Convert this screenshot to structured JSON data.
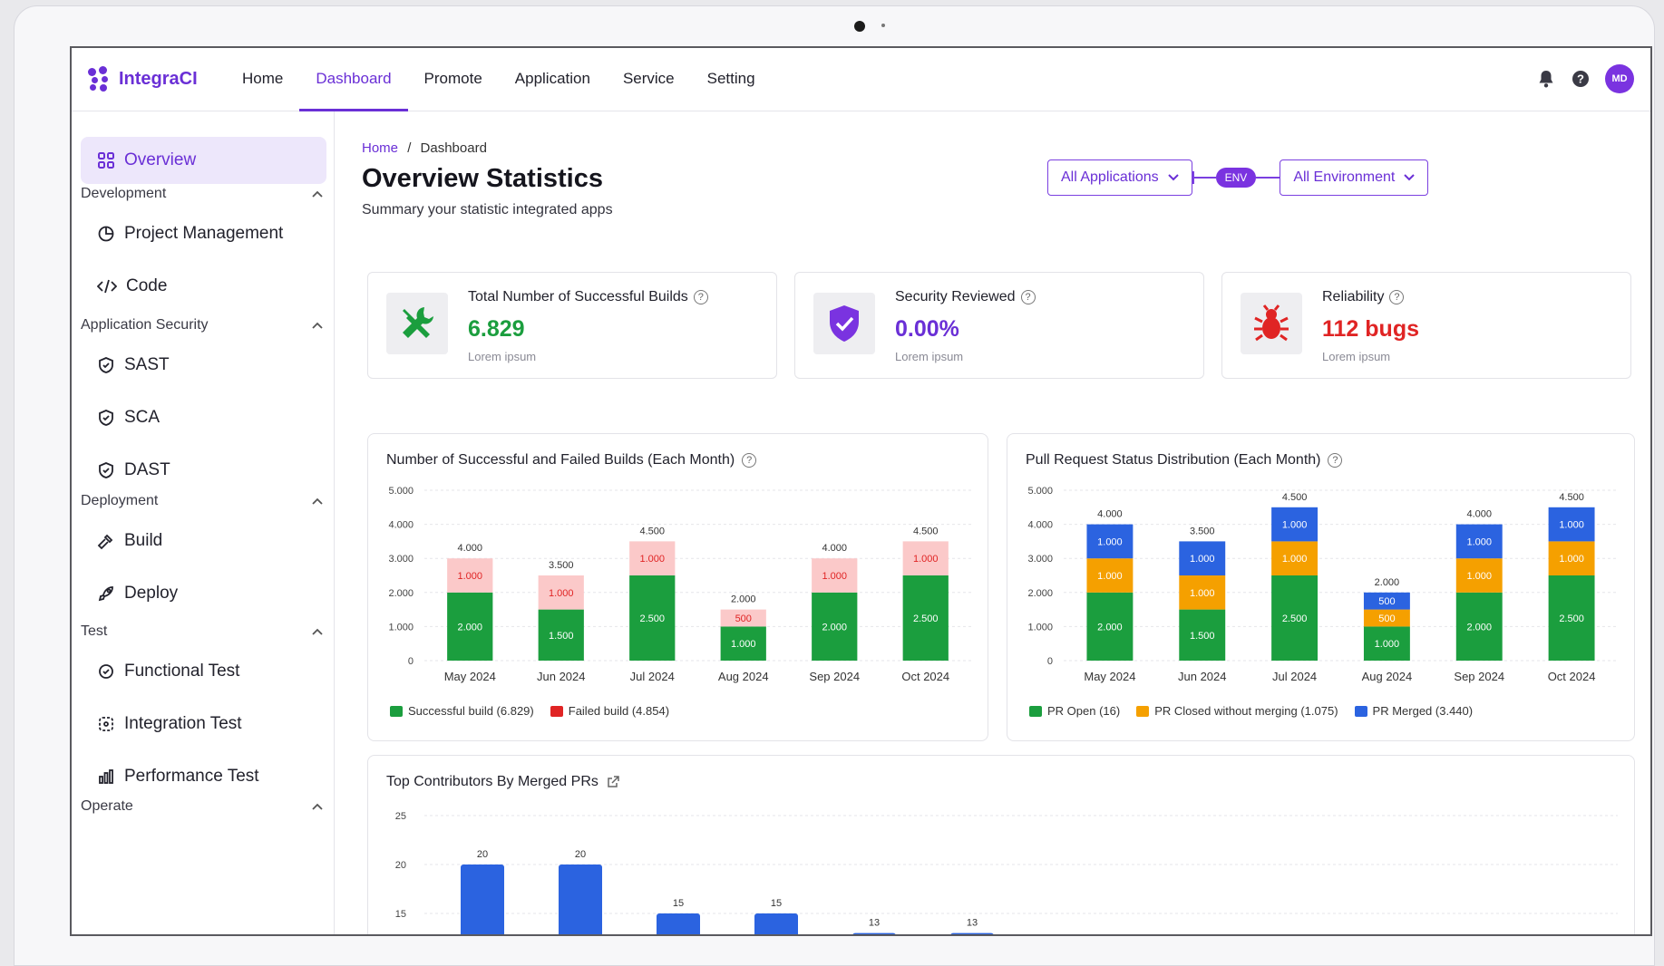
{
  "app": {
    "name": "IntegraCI",
    "avatar_initials": "MD",
    "colors": {
      "accent": "#6a2fd6",
      "success": "#1b9e3e",
      "danger": "#e02424",
      "warning": "#f5a000",
      "blue": "#2b63e0"
    }
  },
  "nav": {
    "items": [
      "Home",
      "Dashboard",
      "Promote",
      "Application",
      "Service",
      "Setting"
    ],
    "active": "Dashboard",
    "icons": [
      "bell-icon",
      "help-icon"
    ]
  },
  "sidebar": {
    "overview": "Overview",
    "groups": [
      {
        "title": "Development",
        "items": [
          {
            "label": "Project Management",
            "icon": "project-icon"
          },
          {
            "label": "Code",
            "icon": "code-icon"
          }
        ]
      },
      {
        "title": "Application Security",
        "items": [
          {
            "label": "SAST",
            "icon": "shield-check-icon"
          },
          {
            "label": "SCA",
            "icon": "shield-check-icon"
          },
          {
            "label": "DAST",
            "icon": "shield-check-icon"
          }
        ]
      },
      {
        "title": "Deployment",
        "items": [
          {
            "label": "Build",
            "icon": "hammer-icon"
          },
          {
            "label": "Deploy",
            "icon": "rocket-icon"
          }
        ]
      },
      {
        "title": "Test",
        "items": [
          {
            "label": "Functional Test",
            "icon": "functional-test-icon"
          },
          {
            "label": "Integration Test",
            "icon": "integration-test-icon"
          },
          {
            "label": "Performance Test",
            "icon": "performance-test-icon"
          }
        ]
      },
      {
        "title": "Operate",
        "items": []
      }
    ]
  },
  "breadcrumb": {
    "home": "Home",
    "sep": "/",
    "current": "Dashboard"
  },
  "page": {
    "title": "Overview Statistics",
    "subtitle": "Summary your statistic integrated apps"
  },
  "filters": {
    "applications": "All Applications",
    "env_badge": "ENV",
    "environment": "All Environment"
  },
  "stats": [
    {
      "label": "Total Number of Successful Builds",
      "value": "6.829",
      "note": "Lorem ipsum",
      "color": "#1b9e3e",
      "icon": "tools-icon"
    },
    {
      "label": "Security Reviewed",
      "value": "0.00%",
      "note": "Lorem ipsum",
      "color": "#6a2fd6",
      "icon": "shield-icon"
    },
    {
      "label": "Reliability",
      "value": "112 bugs",
      "note": "Lorem ipsum",
      "color": "#e02424",
      "icon": "bug-icon"
    }
  ],
  "chart_data": [
    {
      "type": "bar",
      "stacked": true,
      "title": "Number of Successful and Failed Builds (Each Month)",
      "categories": [
        "May 2024",
        "Jun 2024",
        "Jul 2024",
        "Aug 2024",
        "Sep 2024",
        "Oct 2024"
      ],
      "ylim": [
        0,
        5000
      ],
      "yticks": [
        "0",
        "1.000",
        "2.000",
        "3.000",
        "4.000",
        "5.000"
      ],
      "series": [
        {
          "values": [
            2000,
            1500,
            2500,
            1000,
            2000,
            2500
          ],
          "labels": [
            "2.000",
            "1.500",
            "2.500",
            "1.000",
            "2.000",
            "2.500"
          ],
          "color": "#1b9e3e"
        },
        {
          "values": [
            1000,
            1000,
            1000,
            500,
            1000,
            1000
          ],
          "labels": [
            "1.000",
            "1.000",
            "1.000",
            "500",
            "1.000",
            "1.000"
          ],
          "color": "#fbc9c9",
          "text_color": "#e02424"
        }
      ],
      "totals": [
        "4.000",
        "3.500",
        "4.500",
        "2.000",
        "4.000",
        "4.500"
      ],
      "legend": [
        {
          "label": "Successful build (6.829)",
          "color": "#1b9e3e"
        },
        {
          "label": "Failed build (4.854)",
          "color": "#e02424"
        }
      ],
      "grid": true,
      "legend_position": "bottom-left"
    },
    {
      "type": "bar",
      "stacked": true,
      "title": "Pull Request Status Distribution (Each Month)",
      "categories": [
        "May 2024",
        "Jun 2024",
        "Jul 2024",
        "Aug 2024",
        "Sep 2024",
        "Oct 2024"
      ],
      "ylim": [
        0,
        5000
      ],
      "yticks": [
        "0",
        "1.000",
        "2.000",
        "3.000",
        "4.000",
        "5.000"
      ],
      "series": [
        {
          "values": [
            2000,
            1500,
            2500,
            1000,
            2000,
            2500
          ],
          "labels": [
            "2.000",
            "1.500",
            "2.500",
            "1.000",
            "2.000",
            "2.500"
          ],
          "color": "#1b9e3e"
        },
        {
          "values": [
            1000,
            1000,
            1000,
            500,
            1000,
            1000
          ],
          "labels": [
            "1.000",
            "1.000",
            "1.000",
            "500",
            "1.000",
            "1.000"
          ],
          "color": "#f5a000"
        },
        {
          "values": [
            1000,
            1000,
            1000,
            500,
            1000,
            1000
          ],
          "labels": [
            "1.000",
            "1.000",
            "1.000",
            "500",
            "1.000",
            "1.000"
          ],
          "color": "#2b63e0"
        }
      ],
      "totals": [
        "4.000",
        "3.500",
        "4.500",
        "2.000",
        "4.000",
        "4.500"
      ],
      "legend": [
        {
          "label": "PR Open (16)",
          "color": "#1b9e3e"
        },
        {
          "label": "PR Closed without merging (1.075)",
          "color": "#f5a000"
        },
        {
          "label": "PR Merged (3.440)",
          "color": "#2b63e0"
        }
      ],
      "grid": true,
      "legend_position": "bottom-left"
    },
    {
      "type": "bar",
      "title": "Top Contributors By Merged PRs",
      "values": [
        20,
        20,
        15,
        15,
        13,
        13
      ],
      "value_labels": [
        "20",
        "20",
        "15",
        "15",
        "13",
        "13"
      ],
      "yticks": [
        "15",
        "20",
        "25"
      ],
      "ylim": [
        15,
        25
      ],
      "color": "#2b63e0",
      "grid": true
    }
  ]
}
